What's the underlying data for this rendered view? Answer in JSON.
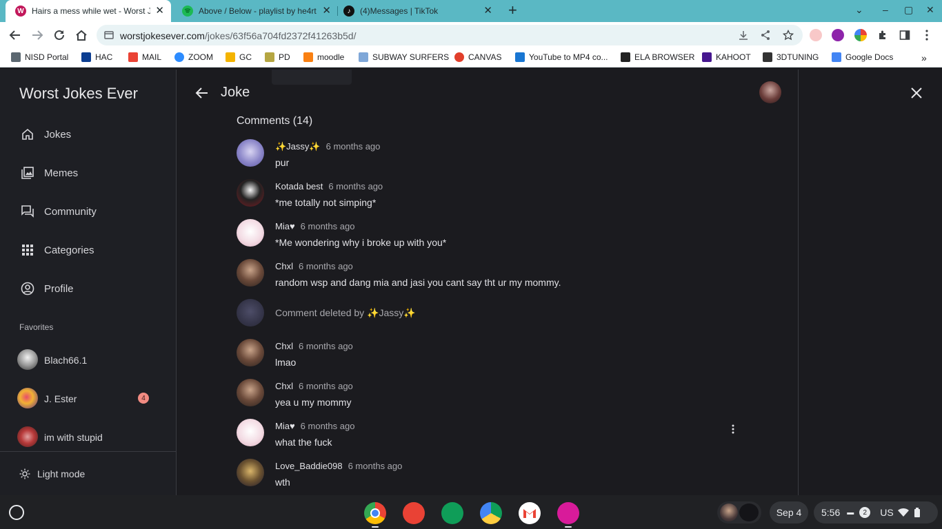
{
  "browser": {
    "tabs": [
      {
        "title": "Hairs a mess while wet - Worst J",
        "favicon": "W",
        "favicon_color": "#c2185b",
        "active": true
      },
      {
        "title": "Above / Below - playlist by he4rt",
        "favicon": "spotify-icon",
        "favicon_color": "#1db954",
        "active": false
      },
      {
        "title": "(4)Messages | TikTok",
        "favicon": "tiktok-icon",
        "favicon_color": "#111111",
        "active": false
      }
    ],
    "url_domain": "worstjokesever.com",
    "url_path": "/jokes/63f56a704fd2372f41263b5d/",
    "bookmarks": [
      {
        "label": "NISD Portal",
        "color": "#5b6770"
      },
      {
        "label": "HAC",
        "color": "#0b3d91"
      },
      {
        "label": "MAIL",
        "color": "#ea4335"
      },
      {
        "label": "ZOOM",
        "color": "#2d8cff"
      },
      {
        "label": "GC",
        "color": "#f4b400"
      },
      {
        "label": "PD",
        "color": "#b5a642"
      },
      {
        "label": "moodle",
        "color": "#f98012"
      },
      {
        "label": "SUBWAY SURFERS",
        "color": "#7fa7d8"
      },
      {
        "label": "CANVAS",
        "color": "#e13f2b"
      },
      {
        "label": "YouTube to MP4 co...",
        "color": "#1976d2"
      },
      {
        "label": "ELA BROWSER",
        "color": "#222222"
      },
      {
        "label": "KAHOOT",
        "color": "#46178f"
      },
      {
        "label": "3DTUNING",
        "color": "#333333"
      },
      {
        "label": "Google Docs",
        "color": "#4285f4"
      }
    ]
  },
  "sidebar": {
    "brand": "Worst Jokes Ever",
    "nav": [
      {
        "label": "Jokes",
        "icon": "home-icon"
      },
      {
        "label": "Memes",
        "icon": "image-icon"
      },
      {
        "label": "Community",
        "icon": "forum-icon"
      },
      {
        "label": "Categories",
        "icon": "grid-icon"
      },
      {
        "label": "Profile",
        "icon": "account-icon"
      }
    ],
    "favorites_heading": "Favorites",
    "favorites": [
      {
        "label": "Blach66.1",
        "badge": ""
      },
      {
        "label": "J. Ester",
        "badge": "4"
      },
      {
        "label": "im with stupid",
        "badge": ""
      }
    ],
    "theme_toggle": "Light mode"
  },
  "main": {
    "title": "Joke",
    "comments_header": "Comments (14)",
    "comments": [
      {
        "name": "✨Jassy✨",
        "time": "6 months ago",
        "text": "pur",
        "deleted": false
      },
      {
        "name": "Kotada best",
        "time": "6 months ago",
        "text": "*me totally not simping*",
        "deleted": false
      },
      {
        "name": "Mia♥",
        "time": "6 months ago",
        "text": "*Me wondering why i broke up with you*",
        "deleted": false
      },
      {
        "name": "Chxl",
        "time": "6 months ago",
        "text": "random wsp and dang mia and jasi you cant say tht ur my mommy.",
        "deleted": false
      },
      {
        "name": "",
        "time": "",
        "text": "Comment deleted by ✨Jassy✨",
        "deleted": true
      },
      {
        "name": "Chxl",
        "time": "6 months ago",
        "text": "lmao",
        "deleted": false
      },
      {
        "name": "Chxl",
        "time": "6 months ago",
        "text": "yea u my mommy",
        "deleted": false
      },
      {
        "name": "Mia♥",
        "time": "6 months ago",
        "text": "what the fuck",
        "deleted": false
      },
      {
        "name": "Love_Baddie098",
        "time": "6 months ago",
        "text": "wth",
        "deleted": false
      }
    ]
  },
  "shelf": {
    "apps": [
      "chrome-icon",
      "canvas-paint-icon",
      "classroom-icon",
      "drive-icon",
      "gmail-icon",
      "gallery-icon"
    ],
    "date": "Sep 4",
    "time": "5:56",
    "notifications": "2",
    "locale": "US"
  }
}
